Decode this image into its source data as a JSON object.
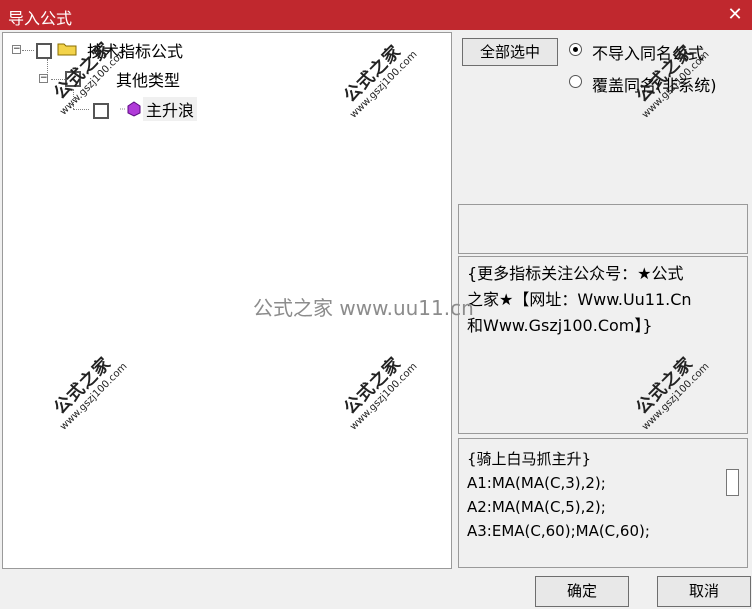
{
  "window": {
    "title": "导入公式",
    "close_symbol": "✕"
  },
  "tree": {
    "root": {
      "label": "技术指标公式",
      "expander": "−"
    },
    "child": {
      "label": "其他类型",
      "expander": "−"
    },
    "leaf": {
      "label": "主升浪"
    }
  },
  "options": {
    "select_all_label": "全部选中",
    "radio_skip_label": "不导入同名公式",
    "radio_overwrite_label": "覆盖同名(非系统)",
    "selected": "skip"
  },
  "description": {
    "line1": "{更多指标关注公众号：★公式",
    "line2": "之家★【网址：Www.Uu11.Cn",
    "line3": "和Www.Gszj100.Com】}"
  },
  "code": {
    "lines": [
      "{骑上白马抓主升}",
      "A1:MA(MA(C,3),2);",
      "A2:MA(MA(C,5),2);",
      "A3:EMA(C,60);MA(C,60);"
    ]
  },
  "buttons": {
    "ok_label": "确定",
    "cancel_label": "取消"
  },
  "watermark": {
    "big": "公式之家",
    "small": "www.gszj100.com",
    "center": "公式之家 www.uu11.cn"
  }
}
